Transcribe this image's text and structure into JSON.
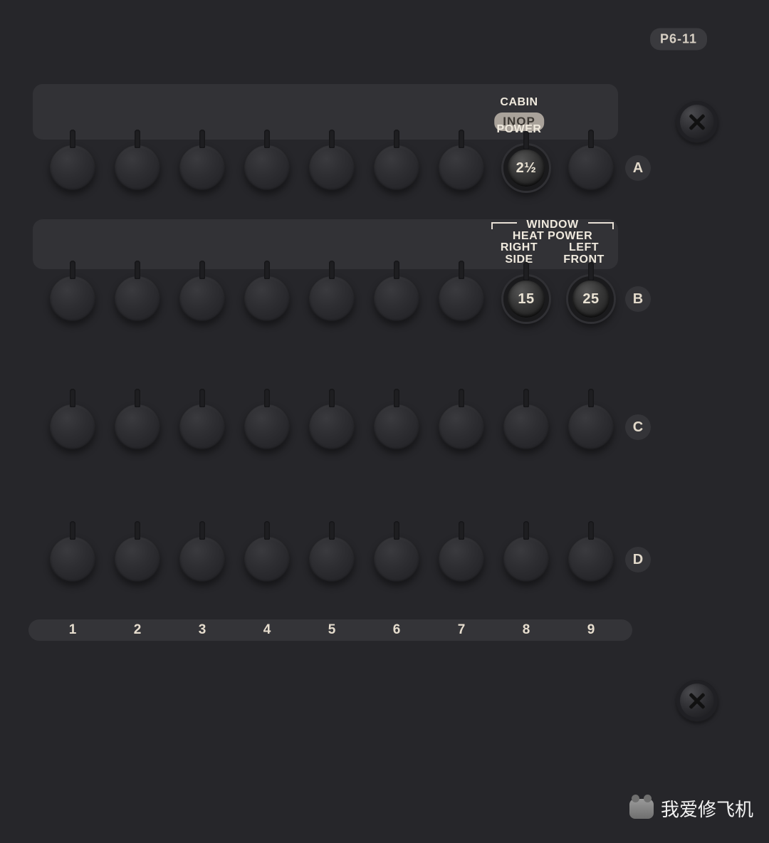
{
  "panel_id": "P6-11",
  "watermark": "我爱修飞机",
  "row_letters": [
    "A",
    "B",
    "C",
    "D"
  ],
  "col_numbers": [
    "1",
    "2",
    "3",
    "4",
    "5",
    "6",
    "7",
    "8",
    "9"
  ],
  "colX": [
    56,
    147,
    238,
    329,
    420,
    511,
    602,
    693,
    784
  ],
  "rowA": {
    "label_upper": "CABIN",
    "label_lower": "POWER",
    "inop": "INOP",
    "breaker8_value": "2½"
  },
  "rowB": {
    "group_title": "WINDOW",
    "group_sub": "HEAT POWER",
    "col8_line1": "RIGHT",
    "col8_line2": "SIDE",
    "col9_line1": "LEFT",
    "col9_line2": "FRONT",
    "breaker8_value": "15",
    "breaker9_value": "25"
  }
}
